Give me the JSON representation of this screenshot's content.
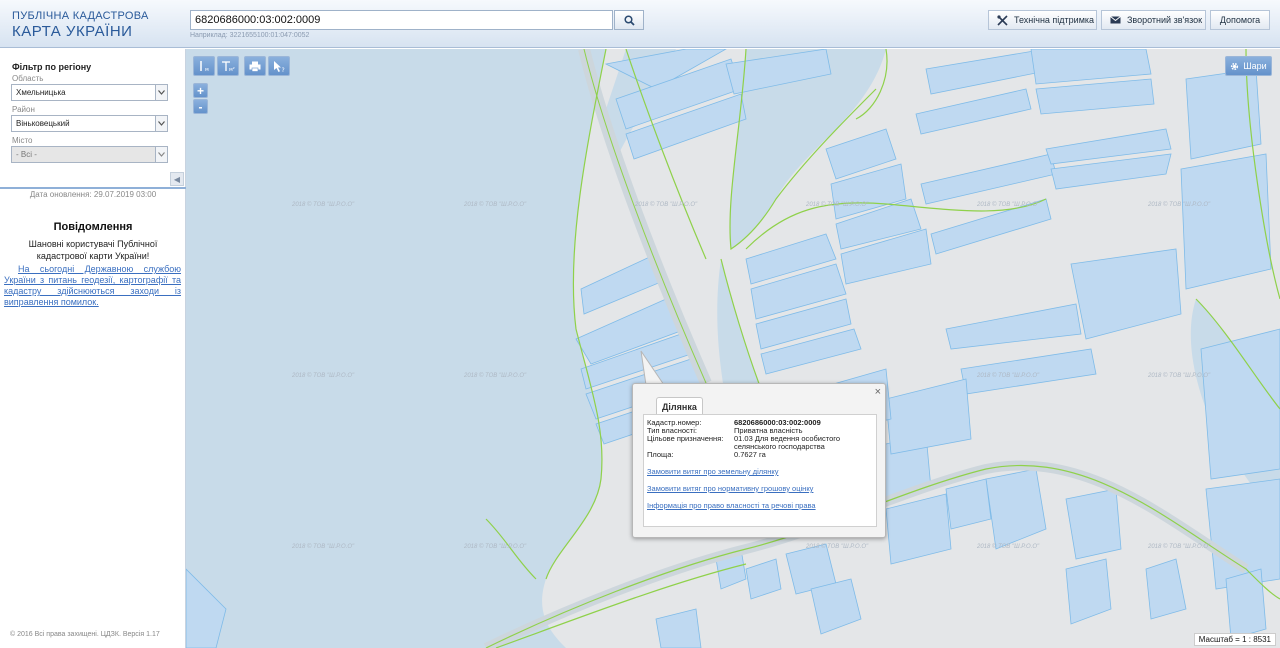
{
  "header": {
    "logo_line1": "ПУБЛІЧНА КАДАСТРОВА",
    "logo_line2": "КАРТА УКРАЇНИ",
    "search_value": "6820686000:03:002:0009",
    "search_hint": "Наприклад: 3221655100:01:047:0052",
    "btn_support": "Технічна підтримка",
    "btn_feedback": "Зворотний зв'язок",
    "btn_help": "Допомога"
  },
  "sidebar": {
    "filter_title": "Фільтр по регіону",
    "region_label": "Область",
    "region_value": "Хмельницька",
    "district_label": "Район",
    "district_value": "Віньковецький",
    "city_label": "Місто",
    "city_value": "- Всі -",
    "update_date": "Дата оновлення: 29.07.2019 03:00",
    "notice_title": "Повідомлення",
    "notice_greeting": "Шановні користувачі Публічної кадастрової карти України!",
    "notice_link": "На сьогодні Державною службою України з питань геодезії, картографії та кадастру здійснюються заходи із виправлення помилок.",
    "footer": "© 2016 Всі права захищені. ЦДЗК. Версія 1.17"
  },
  "map": {
    "watermark": "2018 © ТОВ \"Ш.Р.О.О\"",
    "layers_label": "Шари",
    "scale": "Масштаб = 1 : 8531",
    "zoom_in": "+",
    "zoom_out": "-"
  },
  "popup": {
    "tab": "Ділянка",
    "close": "×",
    "k_number": "Кадастр.номер:",
    "v_number": "6820686000:03:002:0009",
    "k_ownership": "Тип власності:",
    "v_ownership": "Приватна власність",
    "k_purpose": "Цільове призначення:",
    "v_purpose": "01.03 Для ведення особистого селянського господарства",
    "k_area": "Площа:",
    "v_area": "0.7627 га",
    "link1": "Замовити витяг про земельну ділянку",
    "link2": "Замовити витяг про нормативну грошову оцінку",
    "link3": "Інформація про право власності та речові права"
  },
  "colors": {
    "water": "#c8dbe9",
    "parcel_fill": "#bdd8f0",
    "parcel_stroke": "#7fbbe8",
    "boundary": "#8fd14a",
    "land": "#e4e6e8"
  }
}
